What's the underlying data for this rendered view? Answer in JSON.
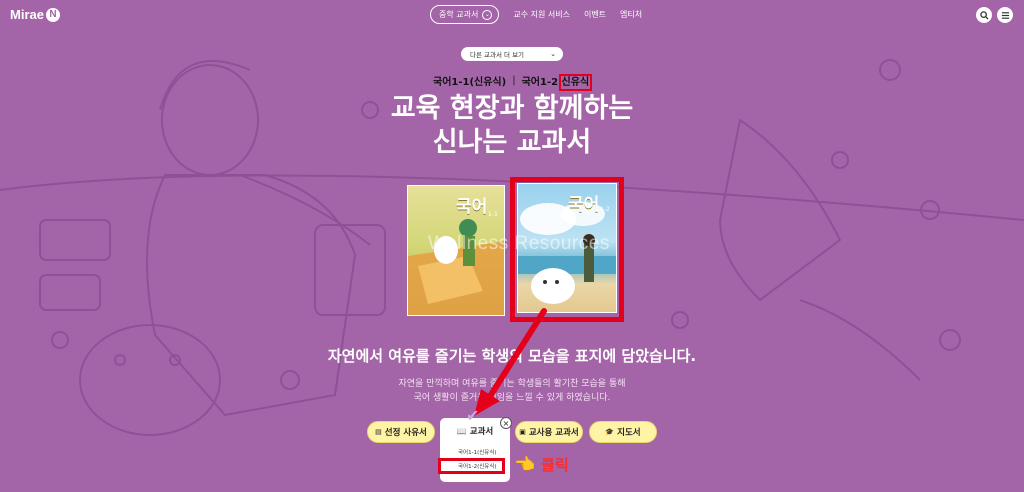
{
  "header": {
    "logo": "Mirae",
    "logo_badge": "N",
    "nav_pill": "중학 교과서",
    "nav_items": [
      "교수 지원 서비스",
      "이벤트",
      "엠티처"
    ],
    "search_icon": "search-icon",
    "menu_icon": "menu-icon"
  },
  "selector": {
    "more_label": "다른 교과서 더 보기"
  },
  "volumes": {
    "vol1": "국어1-1(신유식)",
    "vol2_prefix": "국어1-2",
    "vol2_highlight": "신유식"
  },
  "headline": {
    "line1": "교육 현장과 함께하는",
    "line2": "신나는 교과서"
  },
  "books": {
    "book1_title": "국어",
    "book1_sub": "1-1",
    "book2_title": "국어",
    "book2_sub": "1-2",
    "watermark": "Wellness Resources"
  },
  "subhead": "자연에서 여유를 즐기는 학생의 모습을 표지에 담았습니다.",
  "description": {
    "line1": "자연을 만끽하며 여유를 즐기는 학생들의 활기찬 모습을 통해",
    "line2": "국어 생활이 즐거운 것임을 느낄 수 있게 하였습니다."
  },
  "buttons": {
    "reason": "선정 사유서",
    "textbook": "교과서",
    "teacher": "교사용 교과서",
    "guide": "지도서"
  },
  "dropdown": {
    "items": [
      "국어1-1(신유식)",
      "국어1-2(신유식)"
    ]
  },
  "annotation": {
    "click": "클릭"
  },
  "colors": {
    "background": "#a465a8",
    "highlight": "#e4001b",
    "button": "#fff3a6"
  }
}
